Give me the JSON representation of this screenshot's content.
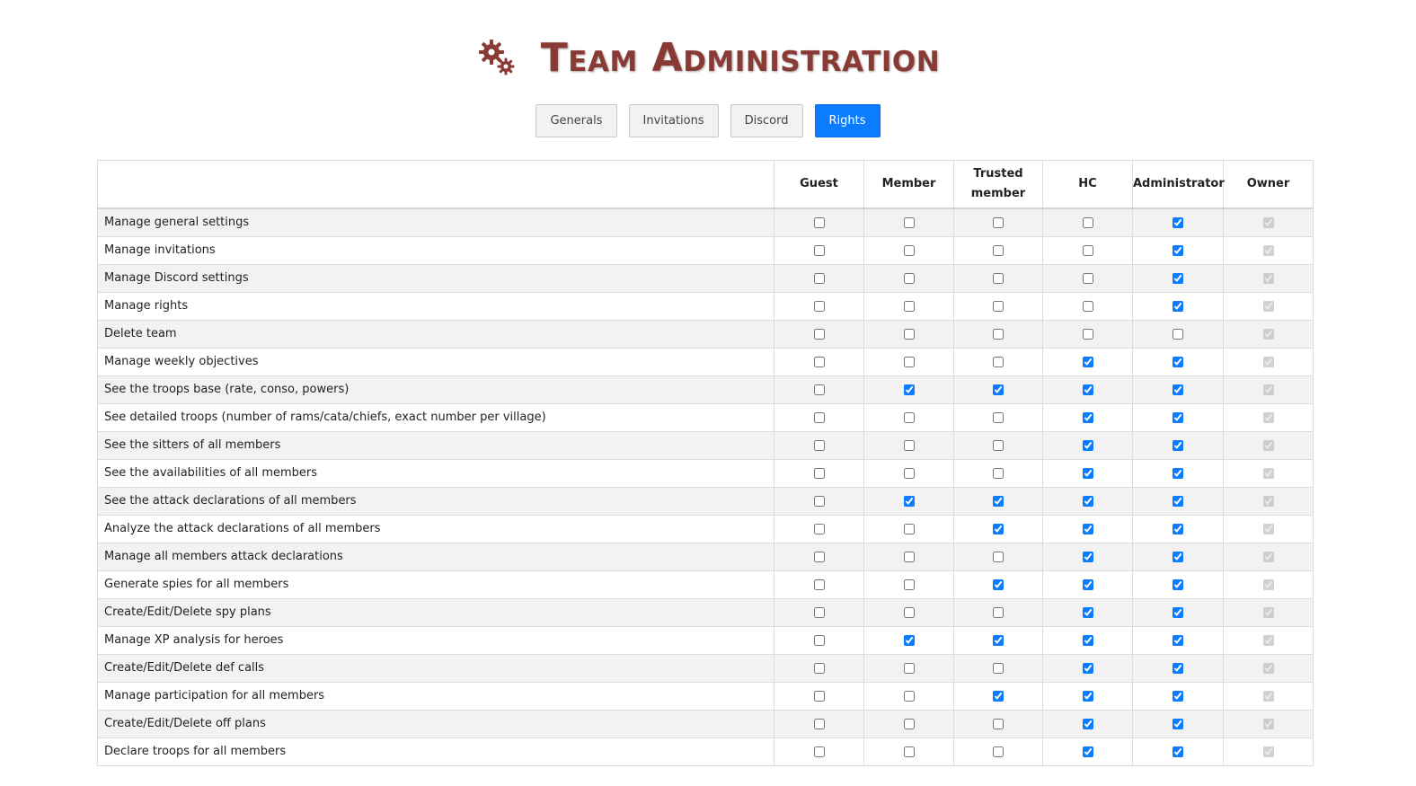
{
  "page": {
    "title": "Team Administration"
  },
  "icons": {
    "title_icon": "gears-icon",
    "title_icon_color": "#8a3a34"
  },
  "colors": {
    "accent": "#0b7cff",
    "title": "#8a3a34"
  },
  "tabs": [
    {
      "label": "Generals",
      "active": false
    },
    {
      "label": "Invitations",
      "active": false
    },
    {
      "label": "Discord",
      "active": false
    },
    {
      "label": "Rights",
      "active": true
    }
  ],
  "rights_table": {
    "columns": [
      {
        "key": "guest",
        "label": "Guest"
      },
      {
        "key": "member",
        "label": "Member"
      },
      {
        "key": "trusted_member",
        "label": "Trusted member"
      },
      {
        "key": "hc",
        "label": "HC"
      },
      {
        "key": "administrator",
        "label": "Administrator"
      },
      {
        "key": "owner",
        "label": "Owner",
        "locked": true
      }
    ],
    "rows": [
      {
        "label": "Manage general settings",
        "checks": [
          false,
          false,
          false,
          false,
          true,
          true
        ]
      },
      {
        "label": "Manage invitations",
        "checks": [
          false,
          false,
          false,
          false,
          true,
          true
        ]
      },
      {
        "label": "Manage Discord settings",
        "checks": [
          false,
          false,
          false,
          false,
          true,
          true
        ]
      },
      {
        "label": "Manage rights",
        "checks": [
          false,
          false,
          false,
          false,
          true,
          true
        ]
      },
      {
        "label": "Delete team",
        "checks": [
          false,
          false,
          false,
          false,
          false,
          true
        ]
      },
      {
        "label": "Manage weekly objectives",
        "checks": [
          false,
          false,
          false,
          true,
          true,
          true
        ]
      },
      {
        "label": "See the troops base (rate, conso, powers)",
        "checks": [
          false,
          true,
          true,
          true,
          true,
          true
        ]
      },
      {
        "label": "See detailed troops (number of rams/cata/chiefs, exact number per village)",
        "checks": [
          false,
          false,
          false,
          true,
          true,
          true
        ]
      },
      {
        "label": "See the sitters of all members",
        "checks": [
          false,
          false,
          false,
          true,
          true,
          true
        ]
      },
      {
        "label": "See the availabilities of all members",
        "checks": [
          false,
          false,
          false,
          true,
          true,
          true
        ]
      },
      {
        "label": "See the attack declarations of all members",
        "checks": [
          false,
          true,
          true,
          true,
          true,
          true
        ]
      },
      {
        "label": "Analyze the attack declarations of all members",
        "checks": [
          false,
          false,
          true,
          true,
          true,
          true
        ]
      },
      {
        "label": "Manage all members attack declarations",
        "checks": [
          false,
          false,
          false,
          true,
          true,
          true
        ]
      },
      {
        "label": "Generate spies for all members",
        "checks": [
          false,
          false,
          true,
          true,
          true,
          true
        ]
      },
      {
        "label": "Create/Edit/Delete spy plans",
        "checks": [
          false,
          false,
          false,
          true,
          true,
          true
        ]
      },
      {
        "label": "Manage XP analysis for heroes",
        "checks": [
          false,
          true,
          true,
          true,
          true,
          true
        ]
      },
      {
        "label": "Create/Edit/Delete def calls",
        "checks": [
          false,
          false,
          false,
          true,
          true,
          true
        ]
      },
      {
        "label": "Manage participation for all members",
        "checks": [
          false,
          false,
          true,
          true,
          true,
          true
        ]
      },
      {
        "label": "Create/Edit/Delete off plans",
        "checks": [
          false,
          false,
          false,
          true,
          true,
          true
        ]
      },
      {
        "label": "Declare troops for all members",
        "checks": [
          false,
          false,
          false,
          true,
          true,
          true
        ]
      }
    ]
  }
}
